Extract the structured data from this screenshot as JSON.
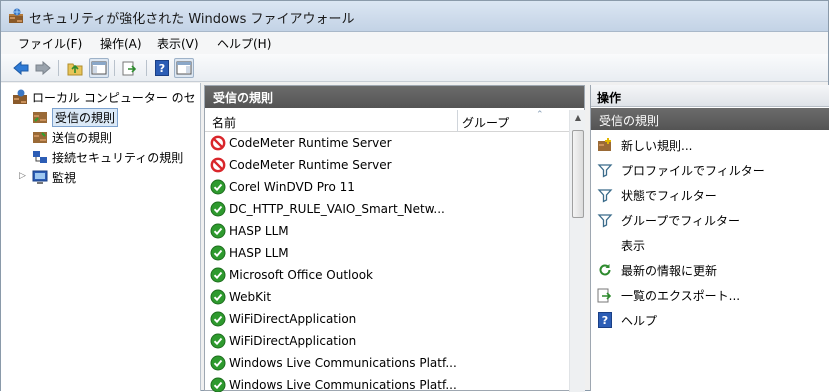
{
  "window": {
    "title": "セキュリティが強化された Windows ファイアウォール"
  },
  "menu": [
    {
      "label": "ファイル(F)"
    },
    {
      "label": "操作(A)"
    },
    {
      "label": "表示(V)"
    },
    {
      "label": "ヘルプ(H)"
    }
  ],
  "toolbar": {
    "icons": [
      "back-icon",
      "forward-icon",
      "up-folder-icon",
      "show-hide-tree-icon",
      "export-list-icon",
      "help-icon",
      "show-hide-action-pane-icon"
    ]
  },
  "tree": {
    "root": "ローカル コンピューター のセ",
    "items": [
      {
        "label": "受信の規則",
        "selected": true
      },
      {
        "label": "送信の規則"
      },
      {
        "label": "接続セキュリティの規則"
      },
      {
        "label": "監視"
      }
    ]
  },
  "middle": {
    "header": "受信の規則",
    "columns": [
      "名前",
      "グループ"
    ],
    "rules": [
      {
        "name": "CodeMeter Runtime Server",
        "status": "blocked"
      },
      {
        "name": "CodeMeter Runtime Server",
        "status": "blocked"
      },
      {
        "name": "Corel WinDVD Pro 11",
        "status": "allowed"
      },
      {
        "name": "DC_HTTP_RULE_VAIO_Smart_Netw...",
        "status": "allowed"
      },
      {
        "name": "HASP LLM",
        "status": "allowed"
      },
      {
        "name": "HASP LLM",
        "status": "allowed"
      },
      {
        "name": "Microsoft Office Outlook",
        "status": "allowed"
      },
      {
        "name": "WebKit",
        "status": "allowed"
      },
      {
        "name": "WiFiDirectApplication",
        "status": "allowed"
      },
      {
        "name": "WiFiDirectApplication",
        "status": "allowed"
      },
      {
        "name": "Windows Live Communications Platf...",
        "status": "allowed"
      },
      {
        "name": "Windows Live Communications Platf...",
        "status": "allowed"
      }
    ]
  },
  "actions": {
    "header": "操作",
    "subheader": "受信の規則",
    "items": [
      {
        "label": "新しい規則...",
        "icon": "new-rule-icon"
      },
      {
        "label": "プロファイルでフィルター",
        "icon": "filter-icon"
      },
      {
        "label": "状態でフィルター",
        "icon": "filter-icon"
      },
      {
        "label": "グループでフィルター",
        "icon": "filter-icon"
      },
      {
        "label": "表示",
        "icon": ""
      },
      {
        "label": "最新の情報に更新",
        "icon": "refresh-icon"
      },
      {
        "label": "一覧のエクスポート...",
        "icon": "export-icon"
      },
      {
        "label": "ヘルプ",
        "icon": "help-icon"
      }
    ]
  },
  "colors": {
    "allowed": "#2e9a2e",
    "blocked": "#d9262b",
    "header_dark": "#5d5d5d",
    "selection": "#dbe9f7"
  }
}
